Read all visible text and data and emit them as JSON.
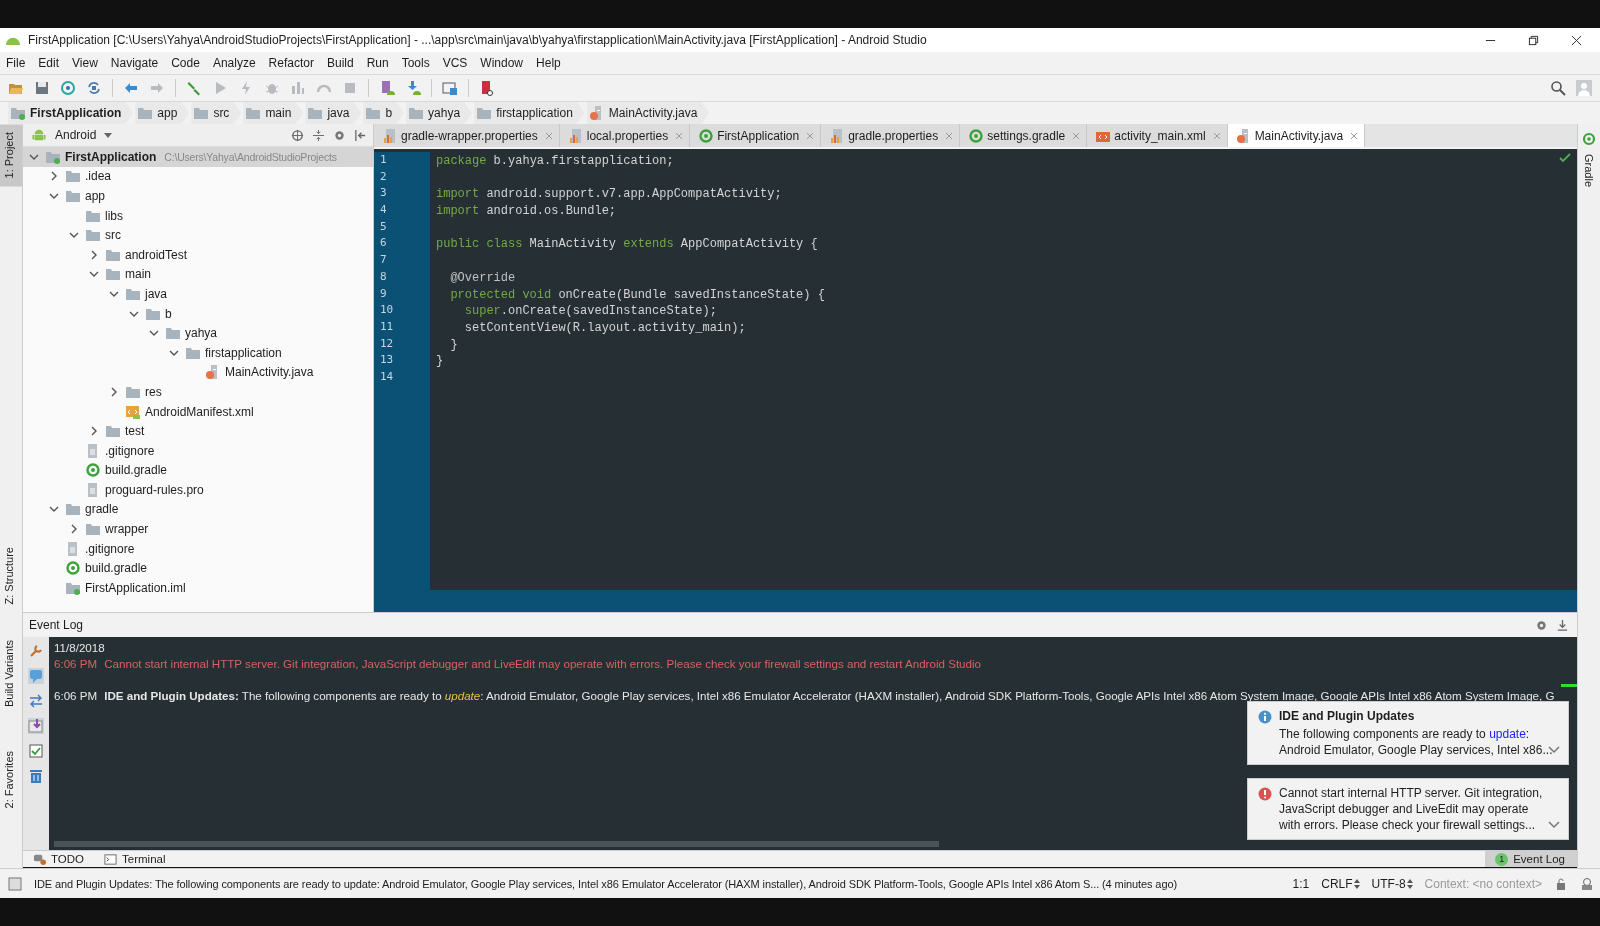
{
  "window": {
    "title": "FirstApplication [C:\\Users\\Yahya\\AndroidStudioProjects\\FirstApplication] - ...\\app\\src\\main\\java\\b\\yahya\\firstapplication\\MainActivity.java [FirstApplication] - Android Studio"
  },
  "menu": [
    "File",
    "Edit",
    "View",
    "Navigate",
    "Code",
    "Analyze",
    "Refactor",
    "Build",
    "Run",
    "Tools",
    "VCS",
    "Window",
    "Help"
  ],
  "breadcrumbs": [
    {
      "label": "FirstApplication",
      "kind": "module"
    },
    {
      "label": "app",
      "kind": "folder"
    },
    {
      "label": "src",
      "kind": "folder"
    },
    {
      "label": "main",
      "kind": "folder"
    },
    {
      "label": "java",
      "kind": "folder"
    },
    {
      "label": "b",
      "kind": "folder"
    },
    {
      "label": "yahya",
      "kind": "folder"
    },
    {
      "label": "firstapplication",
      "kind": "folder"
    },
    {
      "label": "MainActivity.java",
      "kind": "java"
    }
  ],
  "left_strip": {
    "upper": [
      {
        "label": "1: Project",
        "selected": true
      },
      {
        "label": "Z: Structure",
        "selected": false
      }
    ],
    "lower": [
      {
        "label": "Build Variants",
        "selected": false
      },
      {
        "label": "2: Favorites",
        "selected": false
      }
    ]
  },
  "right_strip": [
    {
      "label": "Gradle",
      "selected": false
    }
  ],
  "project_panel": {
    "view": "Android",
    "tree": [
      {
        "label": "FirstApplication",
        "path": "C:\\Users\\Yahya\\AndroidStudioProjects",
        "kind": "module",
        "expanded": true,
        "selected": true,
        "children": [
          {
            "label": ".idea",
            "kind": "folder",
            "expanded": false,
            "selected": false
          },
          {
            "label": "app",
            "kind": "folder",
            "expanded": true,
            "selected": false,
            "children": [
              {
                "label": "libs",
                "kind": "folder",
                "selected": false
              },
              {
                "label": "src",
                "kind": "folder",
                "expanded": true,
                "selected": false,
                "children": [
                  {
                    "label": "androidTest",
                    "kind": "folder",
                    "expanded": false,
                    "selected": false
                  },
                  {
                    "label": "main",
                    "kind": "folder",
                    "expanded": true,
                    "selected": false,
                    "children": [
                      {
                        "label": "java",
                        "kind": "folder",
                        "expanded": true,
                        "selected": false,
                        "children": [
                          {
                            "label": "b",
                            "kind": "folder",
                            "expanded": true,
                            "selected": false,
                            "children": [
                              {
                                "label": "yahya",
                                "kind": "folder",
                                "expanded": true,
                                "selected": false,
                                "children": [
                                  {
                                    "label": "firstapplication",
                                    "kind": "folder",
                                    "expanded": true,
                                    "selected": false,
                                    "children": [
                                      {
                                        "label": "MainActivity.java",
                                        "kind": "java",
                                        "selected": false
                                      }
                                    ]
                                  }
                                ]
                              }
                            ]
                          }
                        ]
                      },
                      {
                        "label": "res",
                        "kind": "folder",
                        "expanded": false,
                        "selected": false
                      },
                      {
                        "label": "AndroidManifest.xml",
                        "kind": "manifest",
                        "selected": false
                      }
                    ]
                  },
                  {
                    "label": "test",
                    "kind": "folder",
                    "expanded": false,
                    "selected": false
                  }
                ]
              },
              {
                "label": ".gitignore",
                "kind": "text",
                "selected": false
              },
              {
                "label": "build.gradle",
                "kind": "gradle",
                "selected": false
              },
              {
                "label": "proguard-rules.pro",
                "kind": "text",
                "selected": false
              }
            ]
          },
          {
            "label": "gradle",
            "kind": "folder",
            "expanded": true,
            "selected": false,
            "children": [
              {
                "label": "wrapper",
                "kind": "folder",
                "expanded": false,
                "selected": false
              }
            ]
          },
          {
            "label": ".gitignore",
            "kind": "text",
            "selected": false
          },
          {
            "label": "build.gradle",
            "kind": "gradle",
            "selected": false
          },
          {
            "label": "FirstApplication.iml",
            "kind": "module",
            "selected": false
          }
        ]
      }
    ]
  },
  "editor": {
    "tabs": [
      {
        "label": "gradle-wrapper.properties",
        "kind": "properties",
        "selected": false
      },
      {
        "label": "local.properties",
        "kind": "properties",
        "selected": false
      },
      {
        "label": "FirstApplication",
        "kind": "gradle",
        "selected": false
      },
      {
        "label": "gradle.properties",
        "kind": "properties",
        "selected": false
      },
      {
        "label": "settings.gradle",
        "kind": "gradle",
        "selected": false
      },
      {
        "label": "activity_main.xml",
        "kind": "xml",
        "selected": false
      },
      {
        "label": "MainActivity.java",
        "kind": "java",
        "selected": true
      }
    ],
    "lines": [
      {
        "number": "1",
        "tokens": [
          {
            "text": "package",
            "kind": "keyword"
          },
          {
            "text": " b.yahya.firstapplication;",
            "kind": "plain"
          }
        ]
      },
      {
        "number": "2"
      },
      {
        "number": "3",
        "tokens": [
          {
            "text": "import",
            "kind": "keyword"
          },
          {
            "text": " android.support.v7.app.AppCompatActivity;",
            "kind": "plain"
          }
        ]
      },
      {
        "number": "4",
        "tokens": [
          {
            "text": "import",
            "kind": "keyword"
          },
          {
            "text": " android.os.Bundle;",
            "kind": "plain"
          }
        ]
      },
      {
        "number": "5"
      },
      {
        "number": "6",
        "tokens": [
          {
            "text": "public class",
            "kind": "keyword"
          },
          {
            "text": " MainActivity ",
            "kind": "plain"
          },
          {
            "text": "extends",
            "kind": "keyword"
          },
          {
            "text": " AppCompatActivity {",
            "kind": "plain"
          }
        ]
      },
      {
        "number": "7"
      },
      {
        "number": "8",
        "tokens": [
          {
            "text": "  @Override",
            "kind": "annotation"
          }
        ]
      },
      {
        "number": "9",
        "tokens": [
          {
            "text": "  protected void",
            "kind": "keyword"
          },
          {
            "text": " onCreate(Bundle savedInstanceState) {",
            "kind": "plain"
          }
        ]
      },
      {
        "number": "10",
        "tokens": [
          {
            "text": "    super",
            "kind": "keyword"
          },
          {
            "text": ".onCreate(savedInstanceState);",
            "kind": "plain"
          }
        ]
      },
      {
        "number": "11",
        "tokens": [
          {
            "text": "    setContentView(R.layout.activity_main);",
            "kind": "plain"
          }
        ]
      },
      {
        "number": "12",
        "tokens": [
          {
            "text": "  }",
            "kind": "plain"
          }
        ]
      },
      {
        "number": "13",
        "tokens": [
          {
            "text": "}",
            "kind": "plain"
          }
        ]
      },
      {
        "number": "14"
      }
    ]
  },
  "event_log": {
    "title": "Event Log",
    "date": "11/8/2018",
    "entries": [
      {
        "time": "6:06 PM",
        "kind": "error",
        "segments": [
          {
            "text": "Cannot start internal HTTP server. Git integration, JavaScript debugger and LiveEdit may operate with errors. Please check your firewall settings and restart Android Studio",
            "kind": "plain"
          }
        ]
      },
      {
        "time": "6:06 PM",
        "kind": "info",
        "segments": [
          {
            "text": "IDE and Plugin Updates:",
            "kind": "title"
          },
          {
            "text": " The following components are ready to ",
            "kind": "plain"
          },
          {
            "text": "update",
            "kind": "link"
          },
          {
            "text": ": Android Emulator, Google Play services, Intel x86 Emulator Accelerator (HAXM installer), Android SDK Platform-Tools, Google APIs Intel x86 Atom System Image, Google APIs Intel x86 Atom System Image, G",
            "kind": "plain"
          }
        ]
      }
    ],
    "notifications": [
      {
        "kind": "info",
        "title": "IDE and Plugin Updates",
        "lines": [
          [
            {
              "text": "The following components are ready to ",
              "kind": "plain"
            },
            {
              "text": "update",
              "kind": "link"
            },
            {
              "text": ":",
              "kind": "plain"
            }
          ],
          [
            {
              "text": "Android Emulator, Google Play services, Intel x86...",
              "kind": "plain"
            }
          ]
        ]
      },
      {
        "kind": "error",
        "lines": [
          [
            {
              "text": "Cannot start internal HTTP server. Git integration,",
              "kind": "plain"
            }
          ],
          [
            {
              "text": "JavaScript debugger and LiveEdit may operate",
              "kind": "plain"
            }
          ],
          [
            {
              "text": "with errors. Please check your firewall settings...",
              "kind": "plain"
            }
          ]
        ]
      }
    ]
  },
  "bottom_tabs": [
    {
      "label": "TODO",
      "kind": "todo"
    },
    {
      "label": "Terminal",
      "kind": "terminal"
    }
  ],
  "event_log_tab": {
    "label": "Event Log",
    "badge": "1",
    "selected": true
  },
  "status_bar": {
    "message": "IDE and Plugin Updates: The following components are ready to update: Android Emulator, Google Play services, Intel x86 Emulator Accelerator (HAXM installer), Android SDK Platform-Tools, Google APIs Intel x86 Atom S... (4 minutes ago)",
    "position": "1:1",
    "line_separator": "CRLF",
    "encoding": "UTF-8",
    "context": "Context: <no context>"
  }
}
